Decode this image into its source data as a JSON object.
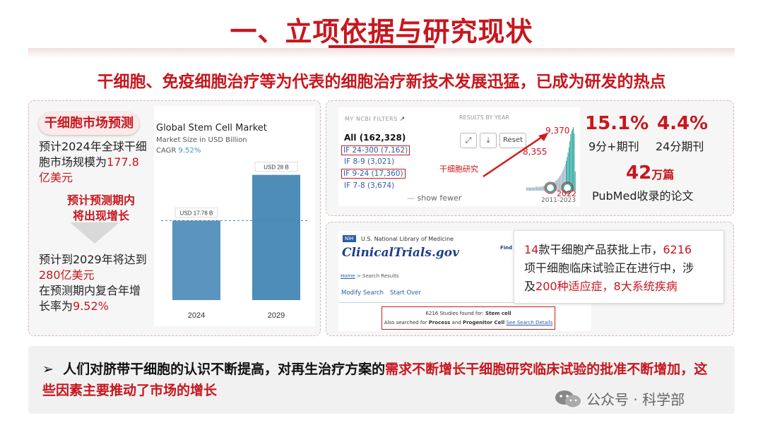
{
  "header": {
    "title": "一、立项依据与研究现状",
    "subtitle": "干细胞、免疫细胞治疗等为代表的细胞治疗新技术发展迅猛，已成为研发的热点"
  },
  "left_panel": {
    "badge": "干细胞市场预测",
    "para1_a": "预计2024年全球干细",
    "para1_b": "胞市场规模为",
    "para1_c": "177.8",
    "para1_d": "亿美元",
    "growth_a": "预计预测期内",
    "growth_b": "将出现增长",
    "para2_a": "预计到2029年将达到",
    "para2_b": "280亿美元",
    "para2_c": "在预测期内复合年增",
    "para2_d": "长率为",
    "para2_e": "9.52%"
  },
  "chart_data": {
    "type": "bar",
    "title": "Global Stem Cell Market",
    "subtitle": "Market Size in USD Billion",
    "cagr_label": "CAGR",
    "cagr_value": "9.52%",
    "categories": [
      "2024",
      "2029"
    ],
    "values": [
      17.78,
      28
    ],
    "value_labels": [
      "USD 17.78 B",
      "USD 28 B"
    ],
    "ylim": [
      0,
      30
    ],
    "colors": [
      "#5b95bf",
      "#4f8db9"
    ]
  },
  "ncbi": {
    "filters_head": "MY NCBI FILTERS",
    "year_head": "RESULTS BY YEAR",
    "items": [
      "All (162,328)",
      "IF 24-300 (7,162)",
      "IF 8-9 (3,021)",
      "IF 9-24 (17,360)",
      "IF 7-8 (3,674)"
    ],
    "show_fewer": "show fewer",
    "reset": "Reset",
    "label": "干细胞研究",
    "v9370": "9,370",
    "v8355": "8,355",
    "v2022": "2022",
    "range": "2011-2023",
    "hist_values": [
      0.05,
      0.05,
      0.05,
      0.05,
      0.05,
      0.05,
      0.05,
      0.05,
      0.05,
      0.05,
      0.06,
      0.06,
      0.06,
      0.06,
      0.06,
      0.06,
      0.06,
      0.07,
      0.07,
      0.07,
      0.07,
      0.08,
      0.08,
      0.08,
      0.09,
      0.09,
      0.1,
      0.1,
      0.11,
      0.12,
      0.13,
      0.14,
      0.15,
      0.16,
      0.17,
      0.19,
      0.21,
      0.23,
      0.25,
      0.28,
      0.31,
      0.34,
      0.38,
      0.42,
      0.47,
      0.53,
      0.6,
      0.68,
      0.78,
      0.89,
      0.94,
      0.97,
      1.0,
      0.9,
      0.3
    ]
  },
  "stats": {
    "s1_value": "15.1%",
    "s1_label": "9分+期刊",
    "s2_value": "4.4%",
    "s2_label": "24分期刊",
    "s3_value": "42",
    "s3_unit": "万篇",
    "s3_label": "PubMed收录的论文"
  },
  "clinicaltrials": {
    "nih": "NIH",
    "nlm": "U.S. National Library of Medicine",
    "logo": "ClinicalTrials.gov",
    "find": "Find",
    "crumb_home": "Home",
    "crumb_sep": " > ",
    "crumb_page": "Search Results",
    "tab_modify": "Modify Search",
    "tab_start": "Start Over",
    "result_line1a": "6216 Studies found for:",
    "result_line1b": "Stem cell",
    "result_line2a": "Also searched for",
    "result_line2b": "Process",
    "result_line2c": "and",
    "result_line2d": "Progenitor Cell",
    "result_line2e": "See Search Details"
  },
  "callout": {
    "n1": "14",
    "t1": "款干细胞产品获批上市，",
    "n2": "6216",
    "t2": "项干细胞临床试验正在进行中，涉",
    "t3": "及",
    "n3": "200种适应症，8大系统疾病"
  },
  "bottom": {
    "bullet": "➢",
    "text_a": "人们对脐带干细胞的认识不断提高，对再生治疗方案的",
    "text_b": "需求不断增长干细胞研究临床试验的批准不断增加，",
    "text_c": "这些因素主要推动了市场的增长"
  },
  "watermark": "公众号 · 科学部"
}
